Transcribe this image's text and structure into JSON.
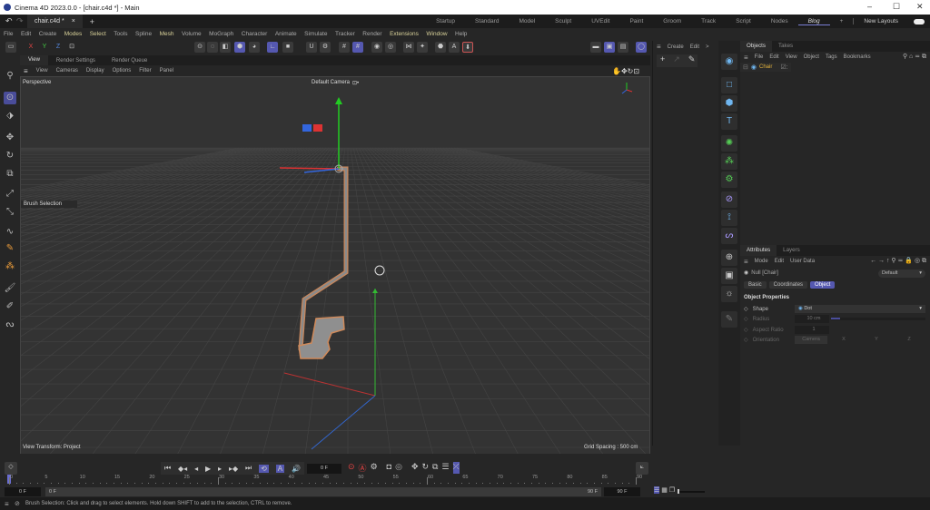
{
  "window": {
    "title": "Cinema 4D 2023.0.0 - [chair.c4d *] - Main",
    "minimize": "–",
    "maximize": "☐",
    "close": "✕"
  },
  "tabs": {
    "doc": "chair.c4d *",
    "close": "×",
    "add": "+"
  },
  "layouts": {
    "items": [
      "Startup",
      "Standard",
      "Model",
      "Sculpt",
      "UVEdit",
      "Paint",
      "Groom",
      "Track",
      "Script",
      "Nodes",
      "Blog"
    ],
    "active": "Blog",
    "add": "+",
    "new_layouts": "New Layouts"
  },
  "menu": [
    "File",
    "Edit",
    "Create",
    "Modes",
    "Select",
    "Tools",
    "Spline",
    "Mesh",
    "Volume",
    "MoGraph",
    "Character",
    "Animate",
    "Simulate",
    "Tracker",
    "Render",
    "Extensions",
    "Window",
    "Help"
  ],
  "menu_highlight": [
    "Modes",
    "Select",
    "Mesh",
    "Extensions",
    "Window"
  ],
  "toolbar": {
    "x": "X",
    "y": "Y",
    "z": "Z"
  },
  "view_tabs": [
    "View",
    "Render Settings",
    "Render Queue"
  ],
  "view_menu": [
    "View",
    "Cameras",
    "Display",
    "Options",
    "Filter",
    "Panel"
  ],
  "viewport": {
    "name": "Perspective",
    "camera": "Default Camera",
    "camera_icon": "⊡•",
    "brush_selection": "Brush Selection",
    "view_transform": "View Transform: Project",
    "grid_spacing": "Grid Spacing : 500 cm"
  },
  "mid_panel": {
    "menu": [
      "Create",
      "Edit",
      ">"
    ]
  },
  "objects": {
    "tabs": [
      "Objects",
      "Takes"
    ],
    "menu": [
      "File",
      "Edit",
      "View",
      "Object",
      "Tags",
      "Bookmarks"
    ],
    "items": [
      {
        "name": "Chair"
      }
    ]
  },
  "attributes": {
    "tabs": [
      "Attributes",
      "Layers"
    ],
    "menu": [
      "Mode",
      "Edit",
      "User Data"
    ],
    "object_name": "Null [Chair]",
    "preset": "Default",
    "subtabs": [
      "Basic",
      "Coordinates",
      "Object"
    ],
    "active_subtab": "Object",
    "section": "Object Properties",
    "props": [
      {
        "label": "Shape",
        "value": "Dot"
      },
      {
        "label": "Radius",
        "value": "10 cm"
      },
      {
        "label": "Aspect Ratio",
        "value": "1"
      },
      {
        "label": "Orientation",
        "options": [
          "Camera",
          "X",
          "Y",
          "Z"
        ]
      }
    ]
  },
  "timeline": {
    "current": "0 F",
    "ticks": [
      "0",
      "5",
      "10",
      "15",
      "20",
      "25",
      "30",
      "35",
      "40",
      "45",
      "50",
      "55",
      "60",
      "65",
      "70",
      "75",
      "80",
      "85",
      "90"
    ],
    "start": "0 F",
    "range_start": "0 F",
    "range_end": "90 F",
    "end": "90 F"
  },
  "status": "Brush Selection: Click and drag to select elements. Hold down SHIFT to add to the selection, CTRL to remove.",
  "colors": {
    "accent": "#5558b0",
    "highlight_menu": "#d9d29a",
    "object_name": "#e6b43c"
  }
}
